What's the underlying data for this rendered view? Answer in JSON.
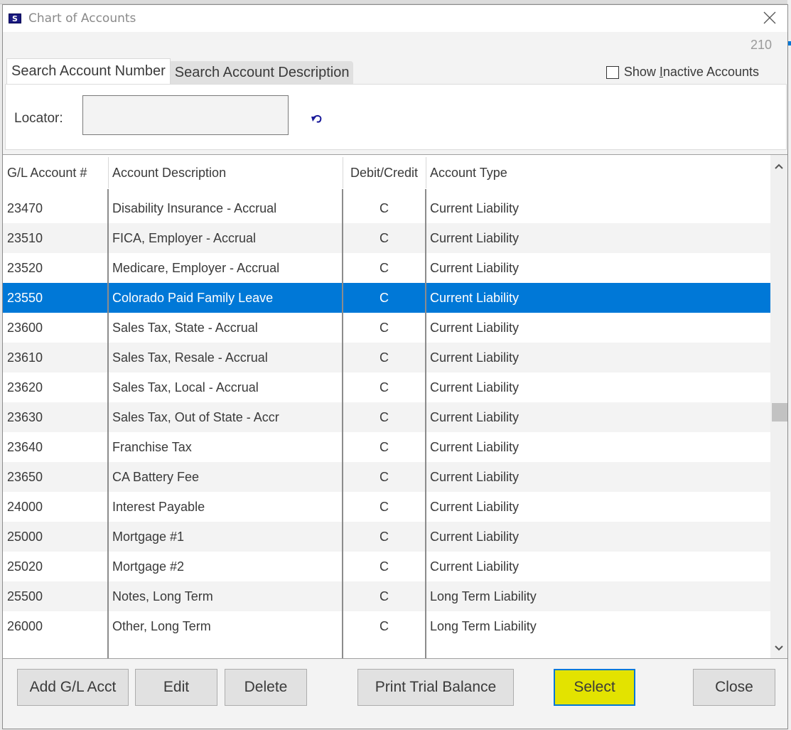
{
  "window": {
    "title": "Chart of Accounts",
    "app_icon": "s-logo-icon",
    "close_icon": "close-icon",
    "counter": "210"
  },
  "tabs": [
    {
      "label": "Search Account Number",
      "active": true
    },
    {
      "label": "Search Account Description",
      "active": false
    }
  ],
  "show_inactive": {
    "label": "Show Inactive Accounts",
    "checked": false
  },
  "locator": {
    "label": "Locator:",
    "value": "",
    "placeholder": "",
    "reset_icon": "undo-icon"
  },
  "grid": {
    "columns": [
      "G/L Account #",
      "Account Description",
      "Debit/Credit",
      "Account Type"
    ],
    "selected_index": 3,
    "rows": [
      {
        "account": "23470",
        "description": "Disability Insurance - Accrual",
        "dc": "C",
        "type": "Current Liability"
      },
      {
        "account": "23510",
        "description": "FICA, Employer - Accrual",
        "dc": "C",
        "type": "Current Liability"
      },
      {
        "account": "23520",
        "description": "Medicare, Employer - Accrual",
        "dc": "C",
        "type": "Current Liability"
      },
      {
        "account": "23550",
        "description": "Colorado Paid Family Leave",
        "dc": "C",
        "type": "Current Liability"
      },
      {
        "account": "23600",
        "description": "Sales Tax, State - Accrual",
        "dc": "C",
        "type": "Current Liability"
      },
      {
        "account": "23610",
        "description": "Sales Tax, Resale - Accrual",
        "dc": "C",
        "type": "Current Liability"
      },
      {
        "account": "23620",
        "description": "Sales Tax, Local - Accrual",
        "dc": "C",
        "type": "Current Liability"
      },
      {
        "account": "23630",
        "description": "Sales Tax, Out of State - Accr",
        "dc": "C",
        "type": "Current Liability"
      },
      {
        "account": "23640",
        "description": "Franchise Tax",
        "dc": "C",
        "type": "Current Liability"
      },
      {
        "account": "23650",
        "description": "CA Battery Fee",
        "dc": "C",
        "type": "Current Liability"
      },
      {
        "account": "24000",
        "description": "Interest Payable",
        "dc": "C",
        "type": "Current Liability"
      },
      {
        "account": "25000",
        "description": "Mortgage #1",
        "dc": "C",
        "type": "Current Liability"
      },
      {
        "account": "25020",
        "description": "Mortgage #2",
        "dc": "C",
        "type": "Current Liability"
      },
      {
        "account": "25500",
        "description": "Notes, Long Term",
        "dc": "C",
        "type": "Long Term Liability"
      },
      {
        "account": "26000",
        "description": "Other, Long Term",
        "dc": "C",
        "type": "Long Term Liability"
      }
    ],
    "scroll_position": 0.5
  },
  "buttons": {
    "add": "Add G/L Acct",
    "edit": "Edit",
    "delete": "Delete",
    "print": "Print Trial Balance",
    "select": "Select",
    "close": "Close"
  },
  "colors": {
    "selection": "#0078d7",
    "select_highlight": "#e3e300"
  }
}
